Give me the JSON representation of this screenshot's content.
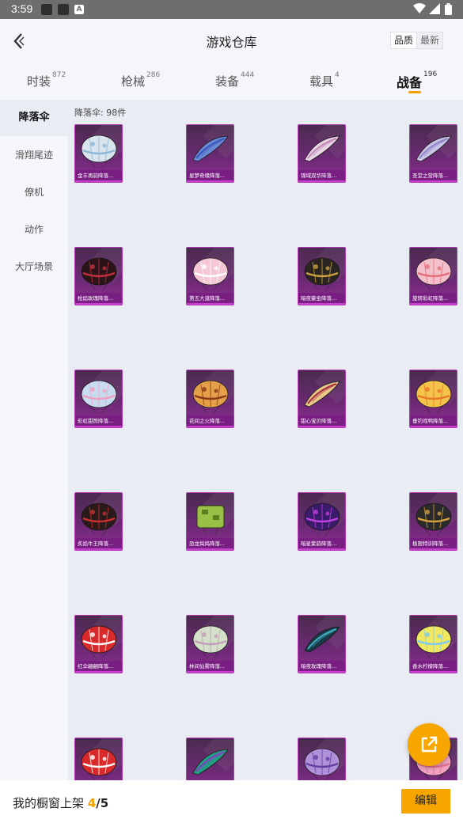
{
  "status_bar": {
    "time": "3:59",
    "icon_letter": "A"
  },
  "header": {
    "title": "游戏仓库",
    "sort_options": [
      "品质",
      "最新"
    ]
  },
  "tabs": [
    {
      "label": "时装",
      "count": "872"
    },
    {
      "label": "枪械",
      "count": "286"
    },
    {
      "label": "装备",
      "count": "444"
    },
    {
      "label": "载具",
      "count": "4"
    },
    {
      "label": "战备",
      "count": "196",
      "active": true
    }
  ],
  "sidebar": {
    "items": [
      {
        "label": "降落伞",
        "active": true
      },
      {
        "label": "滑翔尾迹"
      },
      {
        "label": "僚机"
      },
      {
        "label": "动作"
      },
      {
        "label": "大厅场景"
      }
    ]
  },
  "content": {
    "count_label": "降落伞: 98件",
    "items": [
      {
        "name": "金丰再韵降落...",
        "color": "#d9e4ec",
        "accent": "#8fb7d6",
        "shape": "dome"
      },
      {
        "name": "星梦奇缘降落...",
        "color": "#6a8ad8",
        "accent": "#3a56b8",
        "shape": "wing"
      },
      {
        "name": "锦域双华降落...",
        "color": "#e8d4e4",
        "accent": "#c28ab8",
        "shape": "wing"
      },
      {
        "name": "圣堂之营降落...",
        "color": "#c8c4e6",
        "accent": "#8e84c8",
        "shape": "wing"
      },
      {
        "name": "枪焰玫瑰降落...",
        "color": "#2a1418",
        "accent": "#c23040",
        "shape": "dome"
      },
      {
        "name": "第五大道降落...",
        "color": "#f4c8d4",
        "accent": "#ffffff",
        "shape": "dome"
      },
      {
        "name": "暗夜豪金降落...",
        "color": "#2a2420",
        "accent": "#c8a040",
        "shape": "dome"
      },
      {
        "name": "旋转彩虹降落...",
        "color": "#f4c0cc",
        "accent": "#e4707c",
        "shape": "dome"
      },
      {
        "name": "彩虹甜筒降落...",
        "color": "#c8dcf0",
        "accent": "#f0a0c0",
        "shape": "dome"
      },
      {
        "name": "花间之火降落...",
        "color": "#e4a048",
        "accent": "#8a3a1a",
        "shape": "dome"
      },
      {
        "name": "甜心宝贝降落...",
        "color": "#e8c888",
        "accent": "#a82a40",
        "shape": "wing"
      },
      {
        "name": "垂钓戏鸭降落...",
        "color": "#f4c44a",
        "accent": "#e87828",
        "shape": "dome"
      },
      {
        "name": "炙焰牛王降落...",
        "color": "#2a1a1a",
        "accent": "#c83030",
        "shape": "dome"
      },
      {
        "name": "恐龙捣捣降落...",
        "color": "#9ac048",
        "accent": "#5a8020",
        "shape": "cube"
      },
      {
        "name": "暗星紫韵降落...",
        "color": "#3a1a6a",
        "accent": "#c040e0",
        "shape": "dome"
      },
      {
        "name": "极限特训降落...",
        "color": "#2a2a2a",
        "accent": "#d4a040",
        "shape": "dome"
      },
      {
        "name": "红伞翩翩降落...",
        "color": "#d82a2a",
        "accent": "#ffffff",
        "shape": "dome"
      },
      {
        "name": "林间仙雾降落...",
        "color": "#d4e0c8",
        "accent": "#c0a0b8",
        "shape": "dome"
      },
      {
        "name": "暗夜玫瑰降落...",
        "color": "#1a3a4a",
        "accent": "#40b0c0",
        "shape": "wing"
      },
      {
        "name": "香水柠檬降落...",
        "color": "#f0e860",
        "accent": "#80c8f0",
        "shape": "dome"
      },
      {
        "name": "",
        "color": "#d82a2a",
        "accent": "#ffffff",
        "shape": "dome"
      },
      {
        "name": "",
        "color": "#20a080",
        "accent": "#8040c0",
        "shape": "wing"
      },
      {
        "name": "",
        "color": "#b090d8",
        "accent": "#6040a0",
        "shape": "dome"
      },
      {
        "name": "",
        "color": "#f0a0c0",
        "accent": "#e07090",
        "shape": "dome"
      }
    ]
  },
  "footer": {
    "label": "我的橱窗上架",
    "current": "4",
    "total": "/5",
    "edit_label": "编辑"
  }
}
